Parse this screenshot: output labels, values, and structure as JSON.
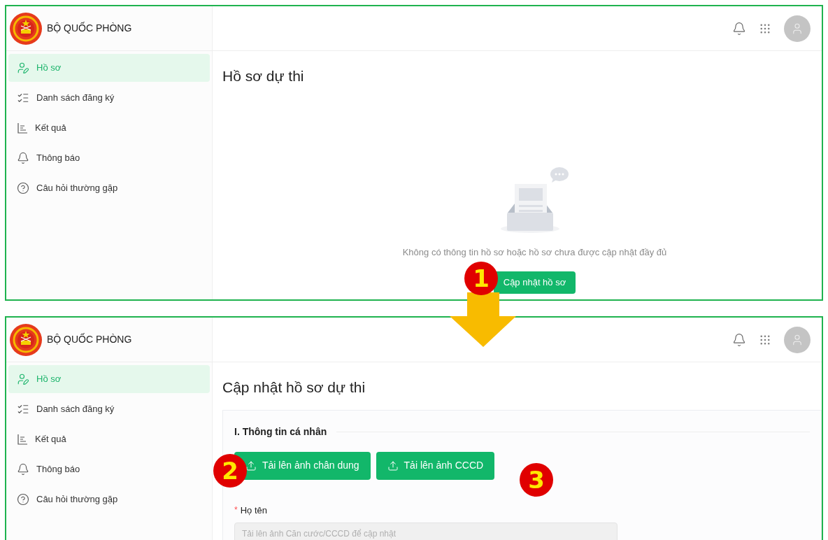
{
  "screens": [
    {
      "brand": "BỘ QUỐC PHÒNG",
      "nav": [
        {
          "kind": "profile",
          "label": "Hồ sơ",
          "selected": true
        },
        {
          "kind": "list",
          "label": "Danh sách đăng ký",
          "selected": false
        },
        {
          "kind": "results",
          "label": "Kết quả",
          "selected": false
        },
        {
          "kind": "bell",
          "label": "Thông báo",
          "selected": false
        },
        {
          "kind": "help",
          "label": "Câu hỏi thường gặp",
          "selected": false
        }
      ],
      "page_title": "Hồ sơ dự thi",
      "content": {
        "kind": "empty",
        "message": "Không có thông tin hồ sơ hoặc hồ sơ chưa được cập nhật đầy đủ",
        "button": "Cập nhật hồ sơ"
      }
    },
    {
      "brand": "BỘ QUỐC PHÒNG",
      "nav": [
        {
          "kind": "profile",
          "label": "Hồ sơ",
          "selected": true
        },
        {
          "kind": "list",
          "label": "Danh sách đăng ký",
          "selected": false
        },
        {
          "kind": "results",
          "label": "Kết quả",
          "selected": false
        },
        {
          "kind": "bell",
          "label": "Thông báo",
          "selected": false
        },
        {
          "kind": "help",
          "label": "Câu hỏi thường gặp",
          "selected": false
        }
      ],
      "page_title": "Cập nhật hồ sơ dự thi",
      "content": {
        "kind": "form",
        "section_title": "I. Thông tin cá nhân",
        "upload_buttons": [
          "Tải lên ảnh chân dung",
          "Tải lên ảnh CCCD"
        ],
        "fields": [
          {
            "required_marker": "*",
            "label": "Họ tên",
            "placeholder": "Tải lên ảnh Căn cước/CCCD để cập nhật",
            "disabled": true
          }
        ]
      }
    }
  ],
  "step_badges": [
    "1",
    "2",
    "3"
  ]
}
